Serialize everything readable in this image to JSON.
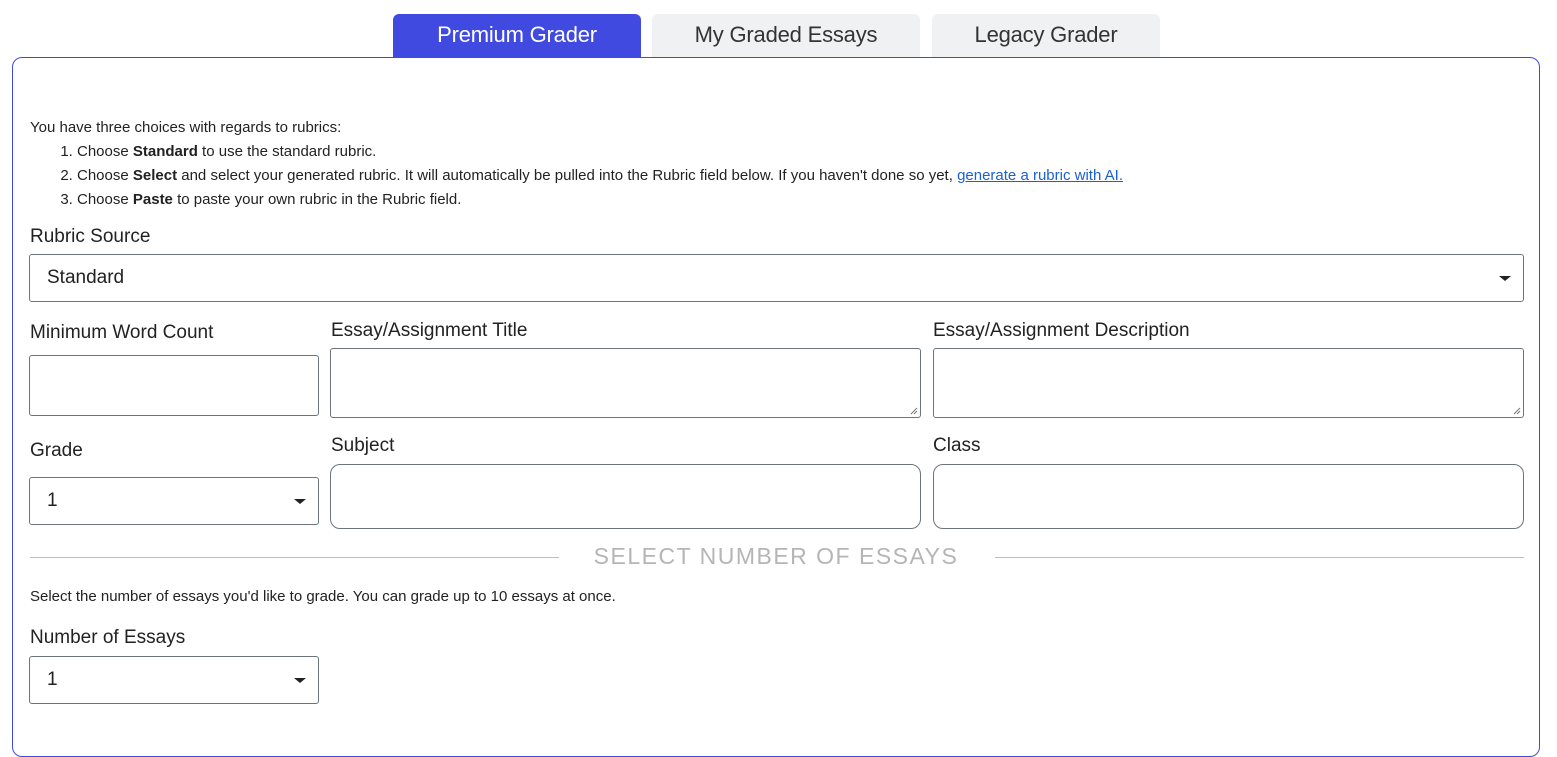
{
  "tabs": [
    {
      "label": "Premium Grader",
      "active": true
    },
    {
      "label": "My Graded Essays",
      "active": false
    },
    {
      "label": "Legacy Grader",
      "active": false
    }
  ],
  "colors": {
    "accent": "#4049e0",
    "link": "#1a5fd6",
    "tab_inactive_bg": "#f0f1f3"
  },
  "intro": {
    "lead": "You have three choices with regards to rubrics:",
    "items": [
      {
        "pre": "Choose ",
        "bold": "Standard",
        "post": " to use the standard rubric."
      },
      {
        "pre": "Choose ",
        "bold": "Select",
        "post": " and select your generated rubric. It will automatically be pulled into the Rubric field below. If you haven't done so yet, ",
        "link": "generate a rubric with AI."
      },
      {
        "pre": "Choose ",
        "bold": "Paste",
        "post": " to paste your own rubric in the Rubric field."
      }
    ]
  },
  "form": {
    "rubric_source": {
      "label": "Rubric Source",
      "value": "Standard",
      "icon": "caret-down-icon"
    },
    "min_word_count": {
      "label": "Minimum Word Count",
      "value": ""
    },
    "title": {
      "label": "Essay/Assignment Title",
      "value": ""
    },
    "description": {
      "label": "Essay/Assignment Description",
      "value": ""
    },
    "grade": {
      "label": "Grade",
      "value": "1",
      "icon": "caret-down-icon"
    },
    "subject": {
      "label": "Subject",
      "value": ""
    },
    "class": {
      "label": "Class",
      "value": ""
    }
  },
  "essays_section": {
    "heading": "SELECT NUMBER OF ESSAYS",
    "helper": "Select the number of essays you'd like to grade. You can grade up to 10 essays at once.",
    "number_label": "Number of Essays",
    "number_value": "1"
  }
}
